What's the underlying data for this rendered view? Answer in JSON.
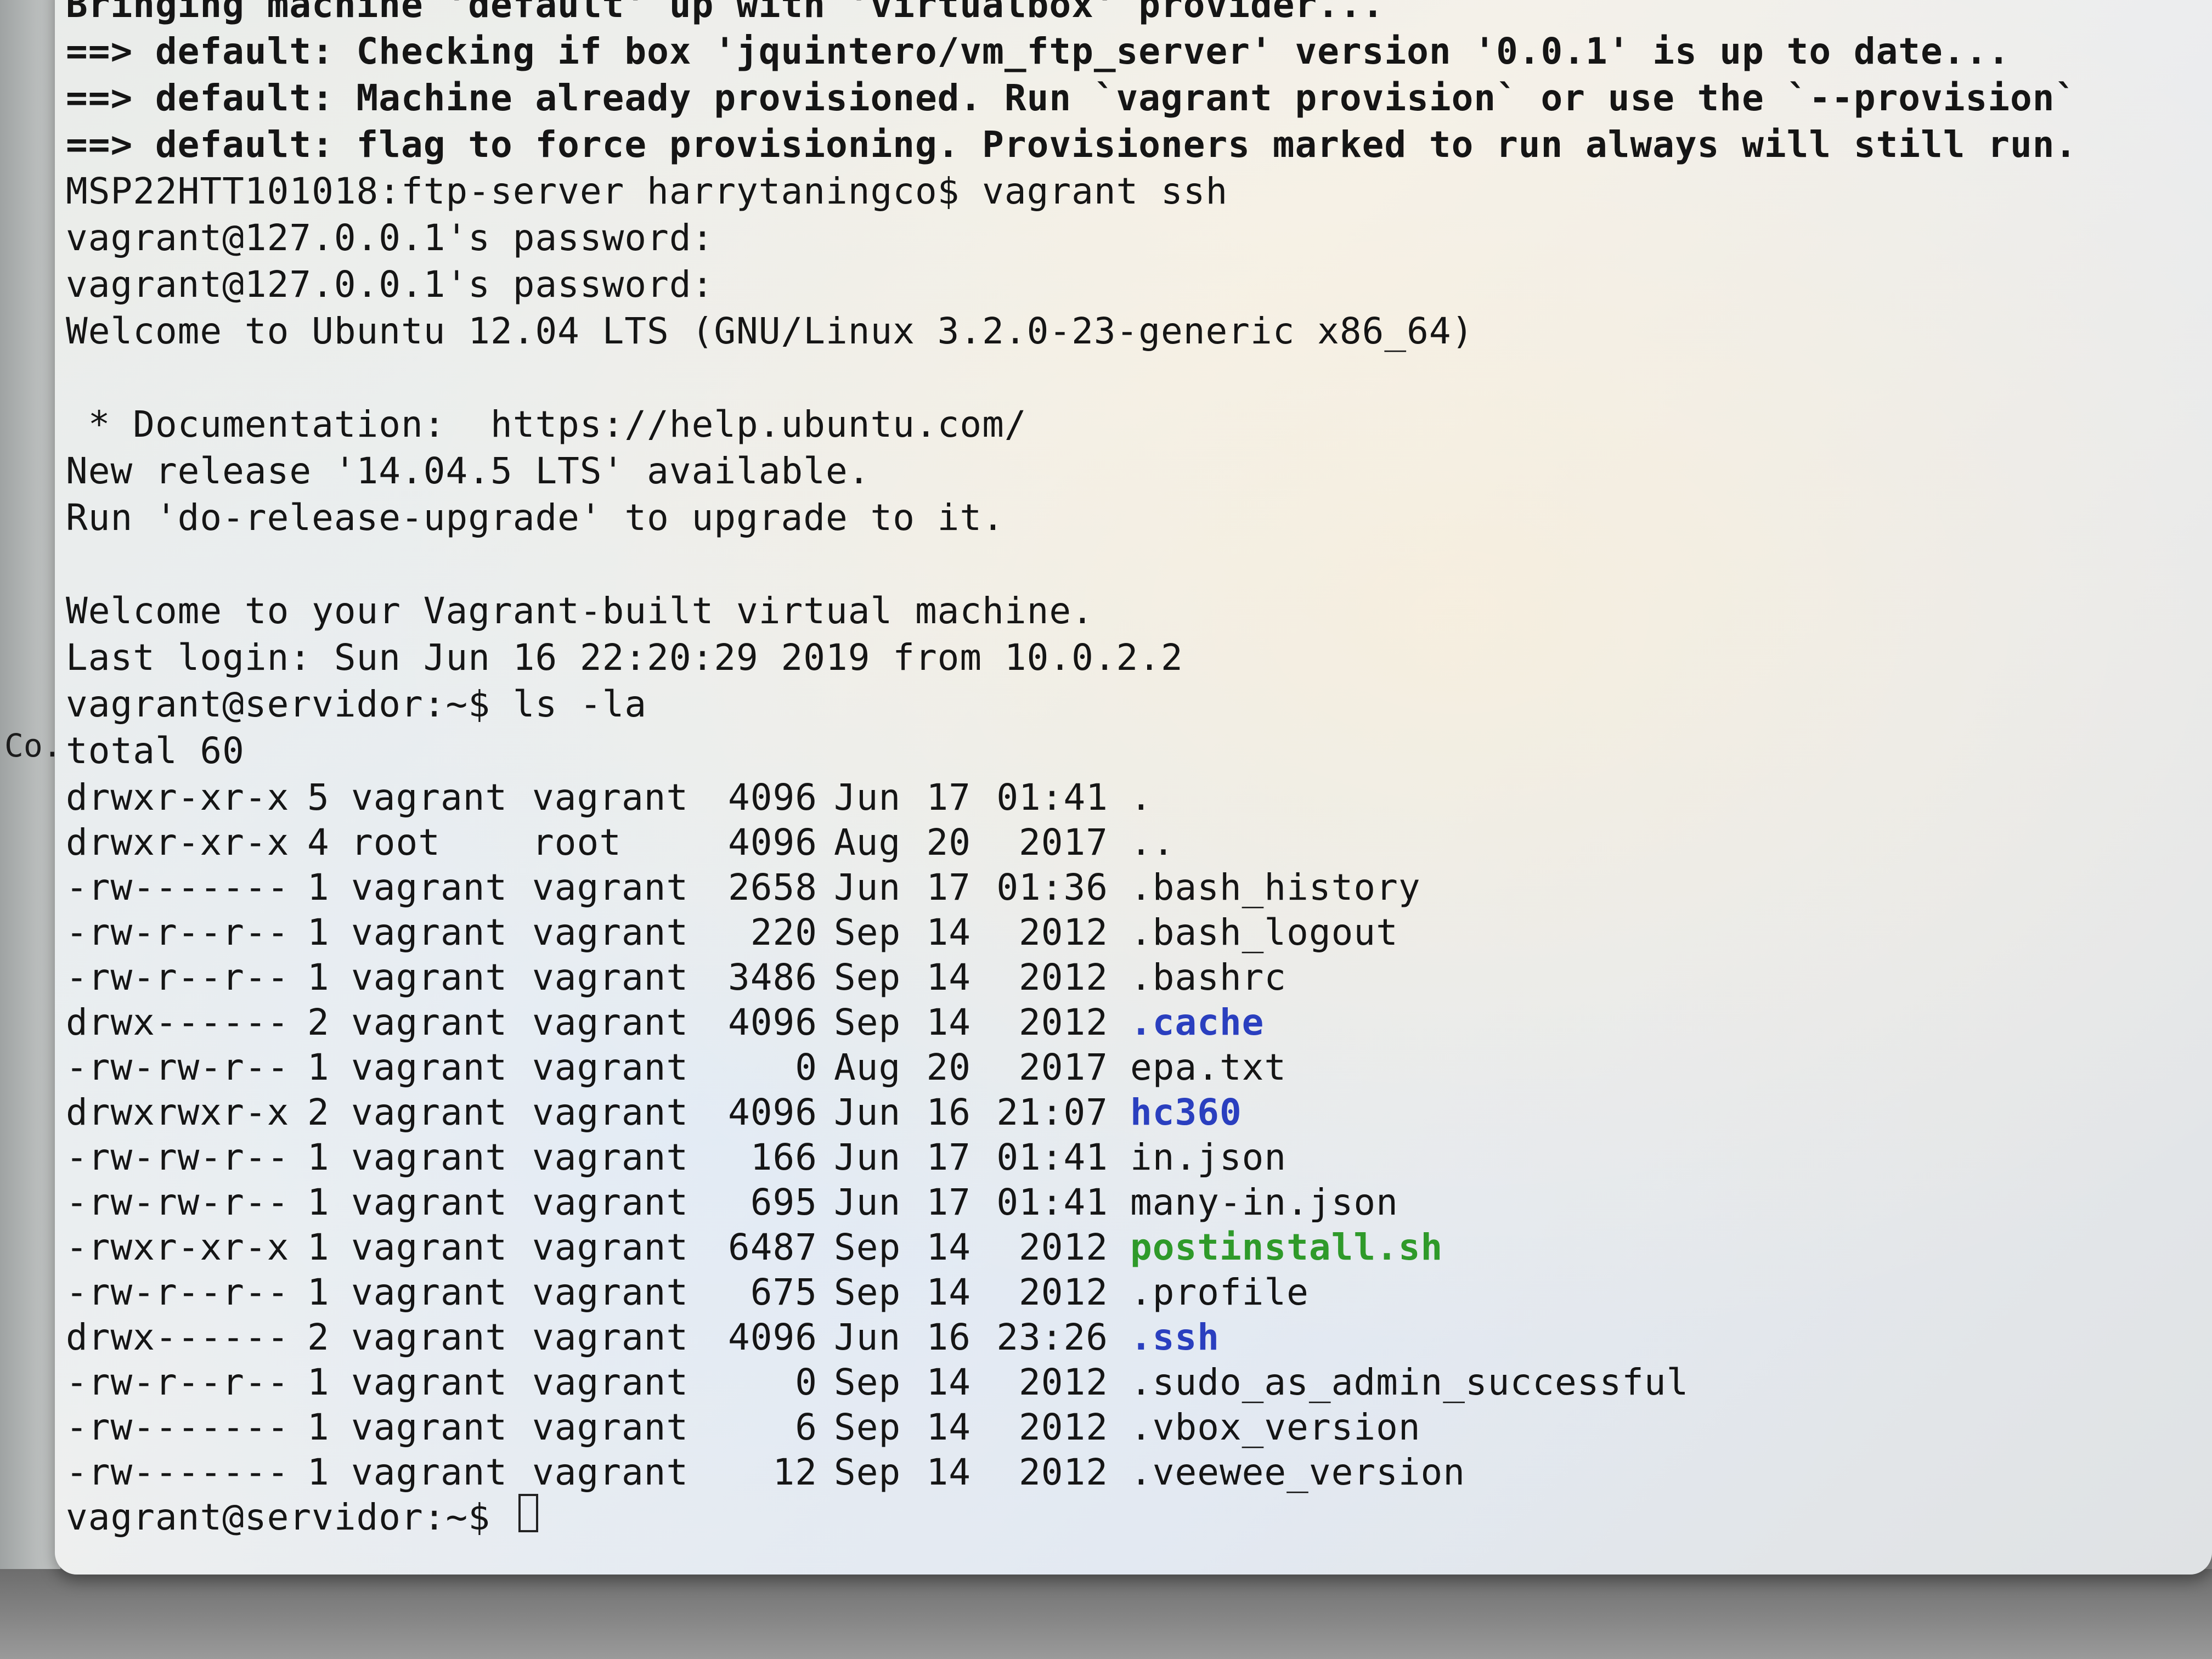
{
  "desktop": {
    "left_label": "Co."
  },
  "terminal": {
    "header_lines": [
      "Bringing machine 'default' up with 'virtualbox' provider...",
      "==> default: Checking if box 'jquintero/vm_ftp_server' version '0.0.1' is up to date...",
      "==> default: Machine already provisioned. Run `vagrant provision` or use the `--provision`",
      "==> default: flag to force provisioning. Provisioners marked to run always will still run."
    ],
    "session_lines": [
      "MSP22HTT101018:ftp-server harrytaningco$ vagrant ssh",
      "vagrant@127.0.0.1's password:",
      "vagrant@127.0.0.1's password:",
      "Welcome to Ubuntu 12.04 LTS (GNU/Linux 3.2.0-23-generic x86_64)",
      "",
      " * Documentation:  https://help.ubuntu.com/",
      "New release '14.04.5 LTS' available.",
      "Run 'do-release-upgrade' to upgrade to it.",
      "",
      "Welcome to your Vagrant-built virtual machine.",
      "Last login: Sun Jun 16 22:20:29 2019 from 10.0.2.2",
      "vagrant@servidor:~$ ls -la",
      "total 60"
    ],
    "listing": [
      {
        "perm": "drwxr-xr-x",
        "links": "5",
        "owner": "vagrant",
        "group": "vagrant",
        "size": "4096",
        "month": "Jun",
        "day": "17",
        "time": "01:41",
        "name": ".",
        "kind": "plain"
      },
      {
        "perm": "drwxr-xr-x",
        "links": "4",
        "owner": "root",
        "group": "root",
        "size": "4096",
        "month": "Aug",
        "day": "20",
        "time": "2017",
        "name": "..",
        "kind": "plain"
      },
      {
        "perm": "-rw-------",
        "links": "1",
        "owner": "vagrant",
        "group": "vagrant",
        "size": "2658",
        "month": "Jun",
        "day": "17",
        "time": "01:36",
        "name": ".bash_history",
        "kind": "plain"
      },
      {
        "perm": "-rw-r--r--",
        "links": "1",
        "owner": "vagrant",
        "group": "vagrant",
        "size": "220",
        "month": "Sep",
        "day": "14",
        "time": "2012",
        "name": ".bash_logout",
        "kind": "plain"
      },
      {
        "perm": "-rw-r--r--",
        "links": "1",
        "owner": "vagrant",
        "group": "vagrant",
        "size": "3486",
        "month": "Sep",
        "day": "14",
        "time": "2012",
        "name": ".bashrc",
        "kind": "plain"
      },
      {
        "perm": "drwx------",
        "links": "2",
        "owner": "vagrant",
        "group": "vagrant",
        "size": "4096",
        "month": "Sep",
        "day": "14",
        "time": "2012",
        "name": ".cache",
        "kind": "dir"
      },
      {
        "perm": "-rw-rw-r--",
        "links": "1",
        "owner": "vagrant",
        "group": "vagrant",
        "size": "0",
        "month": "Aug",
        "day": "20",
        "time": "2017",
        "name": "epa.txt",
        "kind": "plain"
      },
      {
        "perm": "drwxrwxr-x",
        "links": "2",
        "owner": "vagrant",
        "group": "vagrant",
        "size": "4096",
        "month": "Jun",
        "day": "16",
        "time": "21:07",
        "name": "hc360",
        "kind": "dir"
      },
      {
        "perm": "-rw-rw-r--",
        "links": "1",
        "owner": "vagrant",
        "group": "vagrant",
        "size": "166",
        "month": "Jun",
        "day": "17",
        "time": "01:41",
        "name": "in.json",
        "kind": "plain"
      },
      {
        "perm": "-rw-rw-r--",
        "links": "1",
        "owner": "vagrant",
        "group": "vagrant",
        "size": "695",
        "month": "Jun",
        "day": "17",
        "time": "01:41",
        "name": "many-in.json",
        "kind": "plain"
      },
      {
        "perm": "-rwxr-xr-x",
        "links": "1",
        "owner": "vagrant",
        "group": "vagrant",
        "size": "6487",
        "month": "Sep",
        "day": "14",
        "time": "2012",
        "name": "postinstall.sh",
        "kind": "exec"
      },
      {
        "perm": "-rw-r--r--",
        "links": "1",
        "owner": "vagrant",
        "group": "vagrant",
        "size": "675",
        "month": "Sep",
        "day": "14",
        "time": "2012",
        "name": ".profile",
        "kind": "plain"
      },
      {
        "perm": "drwx------",
        "links": "2",
        "owner": "vagrant",
        "group": "vagrant",
        "size": "4096",
        "month": "Jun",
        "day": "16",
        "time": "23:26",
        "name": ".ssh",
        "kind": "dir"
      },
      {
        "perm": "-rw-r--r--",
        "links": "1",
        "owner": "vagrant",
        "group": "vagrant",
        "size": "0",
        "month": "Sep",
        "day": "14",
        "time": "2012",
        "name": ".sudo_as_admin_successful",
        "kind": "plain"
      },
      {
        "perm": "-rw-------",
        "links": "1",
        "owner": "vagrant",
        "group": "vagrant",
        "size": "6",
        "month": "Sep",
        "day": "14",
        "time": "2012",
        "name": ".vbox_version",
        "kind": "plain"
      },
      {
        "perm": "-rw-------",
        "links": "1",
        "owner": "vagrant",
        "group": "vagrant",
        "size": "12",
        "month": "Sep",
        "day": "14",
        "time": "2012",
        "name": ".veewee_version",
        "kind": "plain"
      }
    ],
    "prompt": "vagrant@servidor:~$ ",
    "colors": {
      "dir": "#2a3fbf",
      "exec": "#2f9a2a",
      "text": "#151515"
    }
  }
}
